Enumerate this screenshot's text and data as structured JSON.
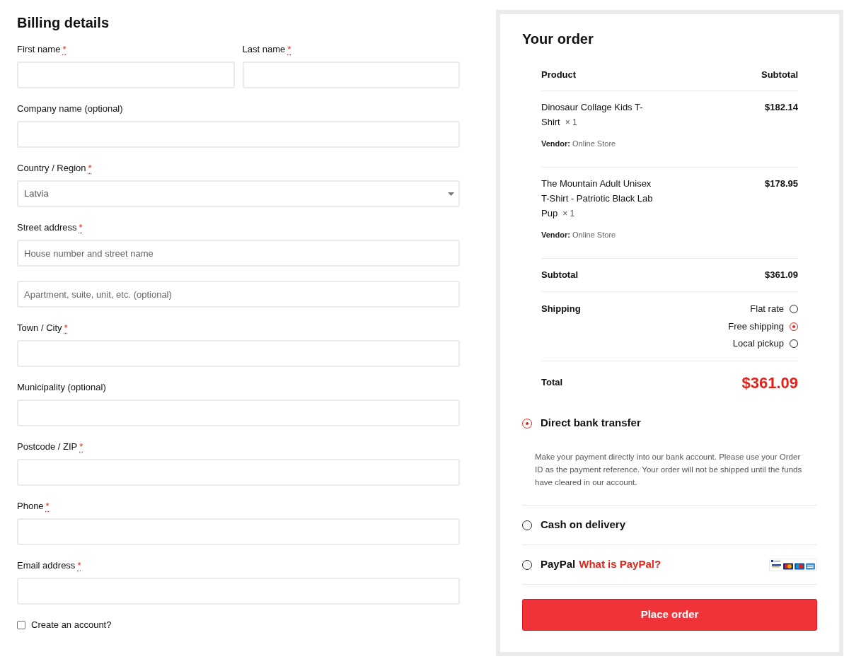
{
  "billing": {
    "title": "Billing details",
    "rows": [
      {
        "fields": [
          {
            "kind": "text",
            "label": "First name",
            "required_mark": "*"
          },
          {
            "kind": "text",
            "label": "Last name",
            "required_mark": "*"
          }
        ]
      },
      {
        "fields": [
          {
            "kind": "text",
            "label": "Company name (optional)"
          }
        ]
      },
      {
        "fields": [
          {
            "kind": "select",
            "label": "Country / Region",
            "required_mark": "*",
            "value": "Latvia"
          }
        ]
      },
      {
        "fields": [
          {
            "kind": "text",
            "label": "Street address",
            "required_mark": "*",
            "placeholder": "House number and street name"
          }
        ]
      },
      {
        "fields": [
          {
            "kind": "text",
            "placeholder": "Apartment, suite, unit, etc. (optional)"
          }
        ]
      },
      {
        "fields": [
          {
            "kind": "text",
            "label": "Town / City",
            "required_mark": "*"
          }
        ]
      },
      {
        "fields": [
          {
            "kind": "text",
            "label": "Municipality (optional)"
          }
        ]
      },
      {
        "fields": [
          {
            "kind": "text",
            "label": "Postcode / ZIP",
            "required_mark": "*"
          }
        ]
      },
      {
        "fields": [
          {
            "kind": "text",
            "label": "Phone",
            "required_mark": "*"
          }
        ]
      },
      {
        "fields": [
          {
            "kind": "text",
            "label": "Email address",
            "required_mark": "*"
          }
        ]
      }
    ],
    "create_account": {
      "label": "Create an account?",
      "checked": false
    }
  },
  "order": {
    "title": "Your order",
    "columns": [
      "Product",
      "Subtotal"
    ],
    "items": [
      {
        "name": "Dinosaur Collage Kids T-Shirt",
        "quantity": "× 1",
        "vendor_label": "Vendor:",
        "vendor": "Online Store",
        "price": "$182.14"
      },
      {
        "name": "The Mountain Adult Unisex T-Shirt - Patriotic Black Lab Pup",
        "quantity": "× 1",
        "vendor_label": "Vendor:",
        "vendor": "Online Store",
        "price": "$178.95"
      }
    ],
    "subtotal": {
      "label": "Subtotal",
      "value": "$361.09"
    },
    "shipping": {
      "label": "Shipping",
      "options": [
        {
          "label": "Flat rate",
          "selected": false
        },
        {
          "label": "Free shipping",
          "selected": true
        },
        {
          "label": "Local pickup",
          "selected": false
        }
      ]
    },
    "total": {
      "label": "Total",
      "value": "$361.09"
    }
  },
  "payment": {
    "methods": [
      {
        "kind": "bank",
        "label": "Direct bank transfer",
        "selected": true,
        "description": "Make your payment directly into our bank account. Please use your Order ID as the payment reference. Your order will not be shipped until the funds have cleared in our account."
      },
      {
        "kind": "cash",
        "label": "Cash on delivery",
        "selected": false
      },
      {
        "kind": "paypal",
        "label": "PayPal",
        "selected": false,
        "link": "What is PayPal?"
      }
    ],
    "button": "Place order"
  }
}
